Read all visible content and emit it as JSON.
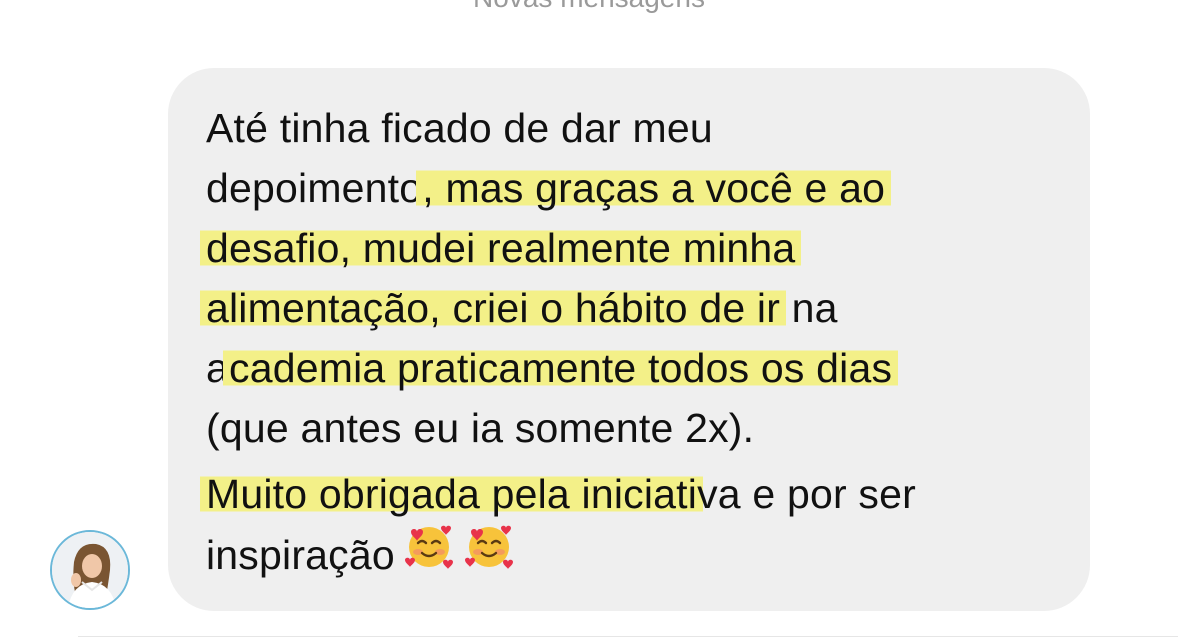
{
  "header": {
    "divider_label": "Novas mensagens"
  },
  "message": {
    "sender_avatar": "profile-photo",
    "lines": [
      {
        "plain_before": "Até tinha ficado de dar meu",
        "highlight": "",
        "plain_after": ""
      },
      {
        "plain_before": "depoimento",
        "highlight": ", mas graças a você e ao",
        "plain_after": ""
      },
      {
        "plain_before": "",
        "highlight": "desafio, mudei realmente minha",
        "plain_after": ""
      },
      {
        "plain_before": "",
        "highlight": "alimentação, criei o hábito de ir",
        "plain_after": " na"
      },
      {
        "plain_before": "a",
        "highlight": "cademia praticamente todos os dias",
        "plain_after": ""
      },
      {
        "plain_before": "(que antes eu ia somente 2x).",
        "highlight": "",
        "plain_after": ""
      },
      {
        "plain_before": "",
        "highlight": "Muito obrigada pela iniciati",
        "plain_after": "va e por ser"
      },
      {
        "plain_before": "inspiração",
        "highlight": "",
        "plain_after": ""
      }
    ],
    "emojis": [
      "smiling-face-with-hearts-emoji",
      "smiling-face-with-hearts-emoji"
    ]
  },
  "colors": {
    "bubble_bg": "#efefef",
    "highlight": "#f3f088",
    "avatar_ring": "#6bb8d9",
    "text": "#111111",
    "divider_text": "#9a9a9a"
  }
}
